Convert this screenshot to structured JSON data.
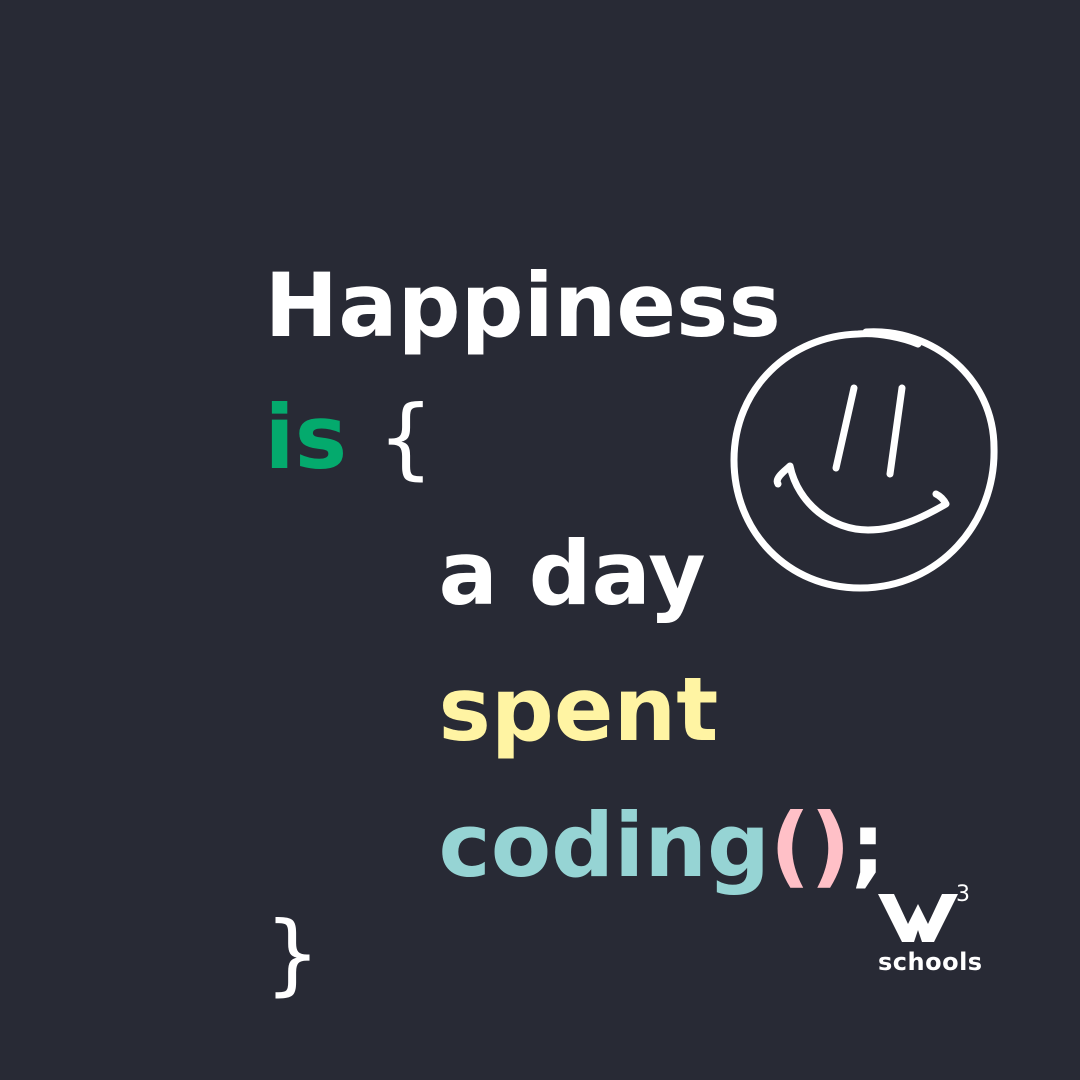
{
  "lines": {
    "l1": "Happiness",
    "l2_keyword": "is",
    "l2_brace": "{",
    "l3": "a day",
    "l4": "spent",
    "l5_word": "coding",
    "l5_open": "(",
    "l5_close": ")",
    "l5_end": ";",
    "l6_brace": "}"
  },
  "logo": {
    "superscript": "3",
    "wordmark": "schools"
  },
  "icons": {
    "smiley": "smiley-face-icon",
    "logo_mark": "w3-logo-icon"
  },
  "colors": {
    "background": "#282a35",
    "white": "#ffffff",
    "green": "#04aa6d",
    "yellow": "#fff4a3",
    "teal": "#96d4d4",
    "pink": "#ffc0c7"
  }
}
